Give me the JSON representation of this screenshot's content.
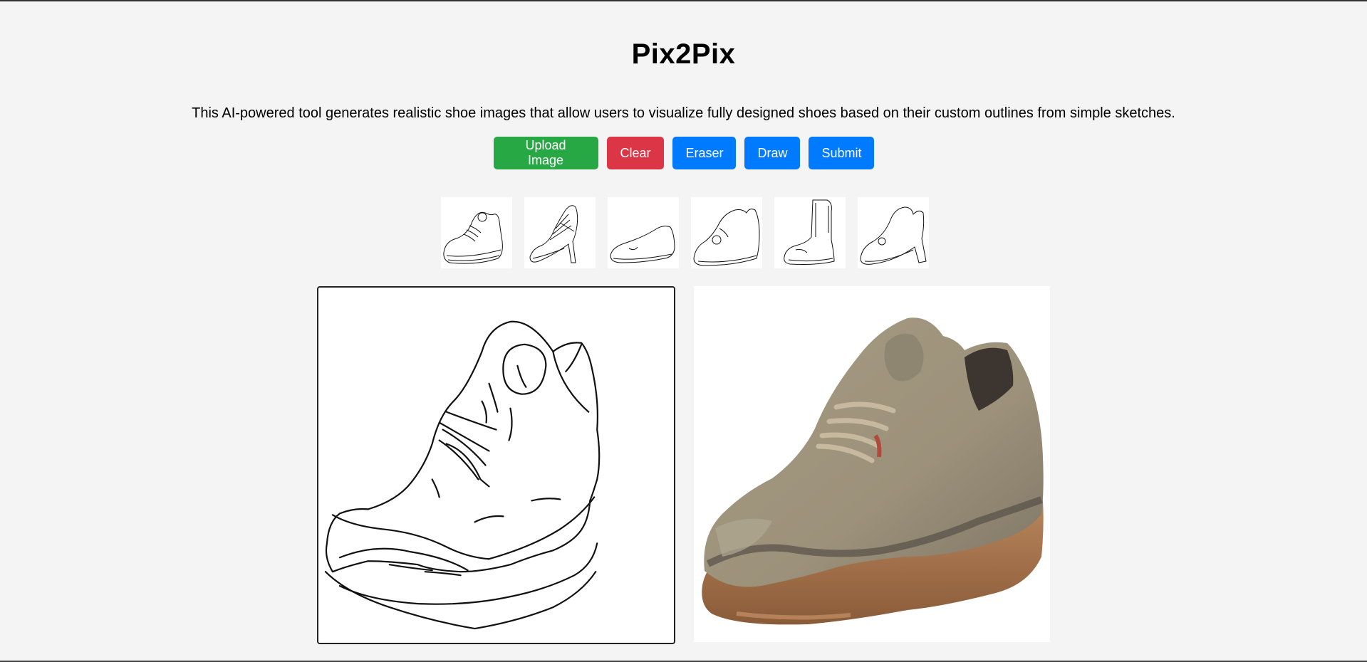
{
  "app": {
    "title": "Pix2Pix",
    "description": "This AI-powered tool generates realistic shoe images that allow users to visualize fully designed shoes based on their custom outlines from simple sketches."
  },
  "toolbar": {
    "upload_label": "Upload Image",
    "clear_label": "Clear",
    "eraser_label": "Eraser",
    "draw_label": "Draw",
    "submit_label": "Submit"
  },
  "examples": [
    {
      "icon": "lace-up-shoe-sketch-icon"
    },
    {
      "icon": "high-heel-sketch-icon"
    },
    {
      "icon": "flat-shoe-sketch-icon"
    },
    {
      "icon": "low-boot-sketch-icon"
    },
    {
      "icon": "tall-boot-sketch-icon"
    },
    {
      "icon": "heeled-ankle-boot-sketch-icon"
    }
  ],
  "colors": {
    "upload": "#28a745",
    "clear": "#dc3545",
    "primary": "#007bff",
    "background": "#f4f4f4"
  }
}
